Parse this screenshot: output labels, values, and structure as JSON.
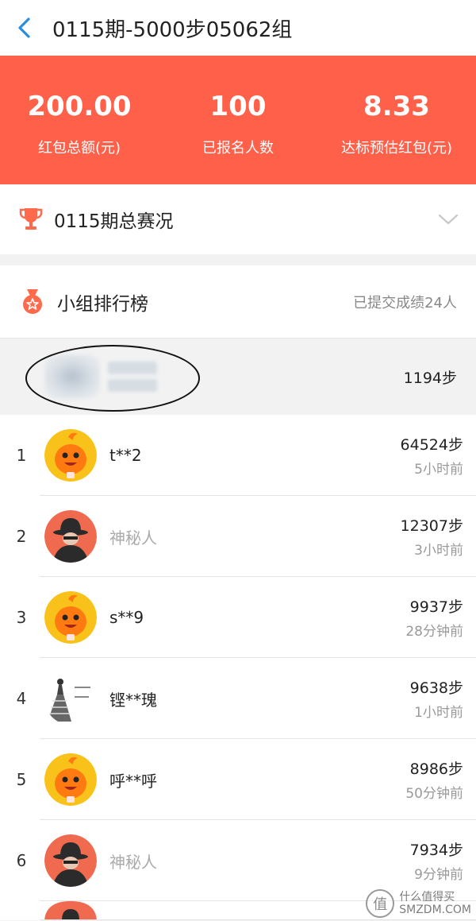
{
  "header": {
    "title": "0115期-5000步05062组"
  },
  "banner": {
    "stats": [
      {
        "value": "200.00",
        "label": "红包总额(元)"
      },
      {
        "value": "100",
        "label": "已报名人数"
      },
      {
        "value": "8.33",
        "label": "达标预估红包(元)"
      }
    ]
  },
  "overview": {
    "title": "0115期总赛况"
  },
  "ranking": {
    "title": "小组排行榜",
    "submitted": "已提交成绩24人",
    "my_steps": "1194步",
    "rows": [
      {
        "rank": "1",
        "name": "t**2",
        "steps": "64524步",
        "time": "5小时前",
        "avatar": "mascot-icon"
      },
      {
        "rank": "2",
        "name": "神秘人",
        "steps": "12307步",
        "time": "3小时前",
        "avatar": "mystery-person-icon"
      },
      {
        "rank": "3",
        "name": "s**9",
        "steps": "9937步",
        "time": "28分钟前",
        "avatar": "mascot-icon"
      },
      {
        "rank": "4",
        "name": "铿**瑰",
        "steps": "9638步",
        "time": "1小时前",
        "avatar": "dress-sketch-icon"
      },
      {
        "rank": "5",
        "name": "呼**呼",
        "steps": "8986步",
        "time": "50分钟前",
        "avatar": "mascot-icon"
      },
      {
        "rank": "6",
        "name": "神秘人",
        "steps": "7934步",
        "time": "9分钟前",
        "avatar": "mystery-person-icon"
      }
    ]
  },
  "watermark": {
    "line1": "什么值得买",
    "line2": "SMZDM.COM"
  },
  "colors": {
    "banner": "#ff604a",
    "accent": "#ff6a4d",
    "back": "#2a8de0"
  }
}
